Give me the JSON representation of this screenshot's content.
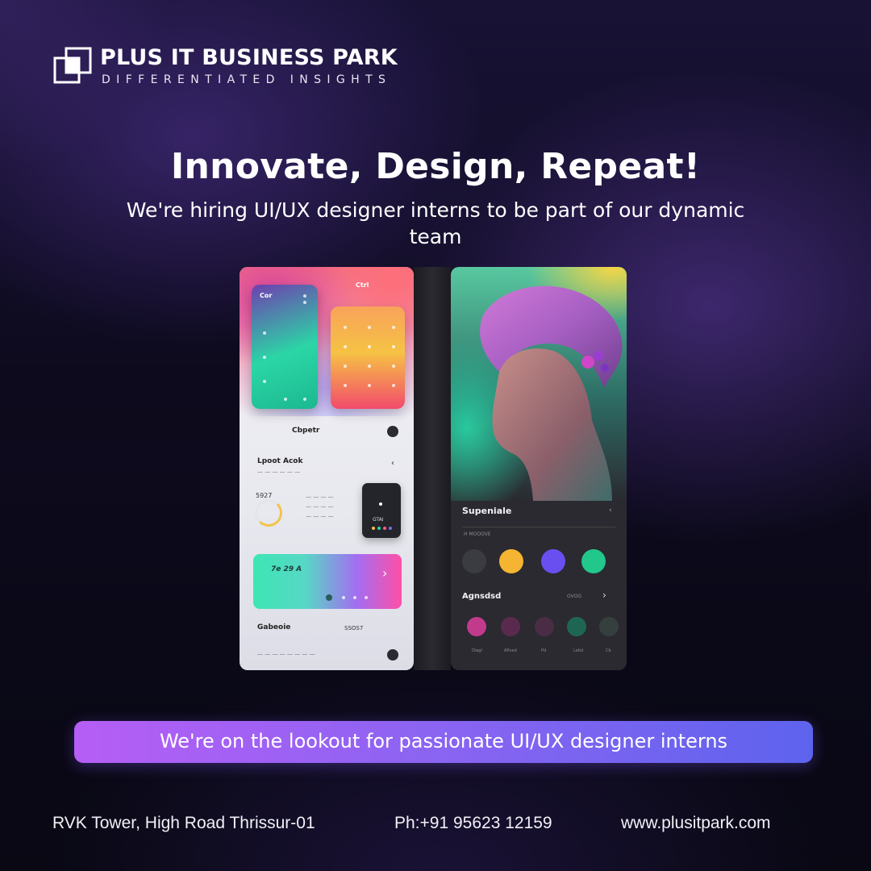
{
  "brand": {
    "name": "PLUS IT BUSINESS PARK",
    "tagline": "DIFFERENTIATED INSIGHTS"
  },
  "headline": "Innovate, Design, Repeat!",
  "subheadline": "We're hiring UI/UX designer interns to be part of our dynamic team",
  "mockup": {
    "left_screen": {
      "card_title": "Cor",
      "header_label": "Ctrl",
      "section_title": "Cbpetr",
      "list_title": "Lpoot Acok",
      "list_value": "5927",
      "chip_label": "GTAI",
      "gradient_card_text": "7e 29 A",
      "footer_title": "Gabeoie",
      "footer_value": "SSOS7"
    },
    "right_screen": {
      "title": "Supeniale",
      "subtitle": "H MOOOVE",
      "section_title": "Agnsdsd",
      "section_action": "OVOG",
      "bottom_labels": [
        "Diagl",
        "Aflved",
        "Pd",
        "Lebd",
        "Cb"
      ]
    }
  },
  "banner": "We're on the lookout for passionate UI/UX designer interns",
  "footer": {
    "address": "RVK Tower, High Road Thrissur-01",
    "phone": "Ph:+91 95623 12159",
    "website": "www.plusitpark.com"
  },
  "colors": {
    "banner_start": "#b65ef5",
    "banner_end": "#5e63ee",
    "background": "#0d0a1d"
  }
}
